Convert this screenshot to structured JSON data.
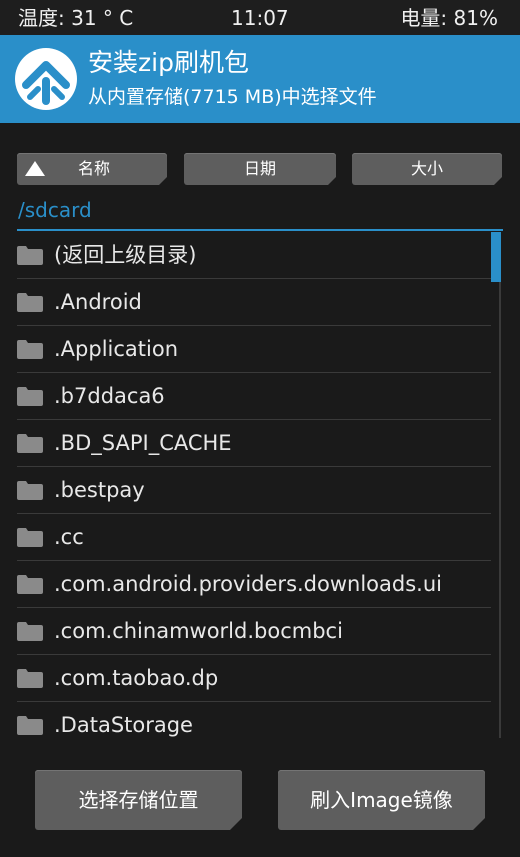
{
  "status_bar": {
    "temperature": "温度: 31 ° C",
    "time": "11:07",
    "battery": "电量: 81%"
  },
  "header": {
    "logo_icon": "twrp-logo-icon",
    "title": "安装zip刷机包",
    "subtitle": "从内置存储(7715 MB)中选择文件"
  },
  "sort_bar": {
    "name_label": "名称",
    "date_label": "日期",
    "size_label": "大小",
    "active_sort_icon": "triangle-up-icon"
  },
  "path": "/sdcard",
  "files": [
    {
      "name": "(返回上级目录)",
      "icon": "folder-icon"
    },
    {
      "name": ".Android",
      "icon": "folder-icon"
    },
    {
      "name": ".Application",
      "icon": "folder-icon"
    },
    {
      "name": ".b7ddaca6",
      "icon": "folder-icon"
    },
    {
      "name": ".BD_SAPI_CACHE",
      "icon": "folder-icon"
    },
    {
      "name": ".bestpay",
      "icon": "folder-icon"
    },
    {
      "name": ".cc",
      "icon": "folder-icon"
    },
    {
      "name": ".com.android.providers.downloads.ui",
      "icon": "folder-icon"
    },
    {
      "name": ".com.chinamworld.bocmbci",
      "icon": "folder-icon"
    },
    {
      "name": ".com.taobao.dp",
      "icon": "folder-icon"
    },
    {
      "name": ".DataStorage",
      "icon": "folder-icon"
    }
  ],
  "buttons": {
    "select_storage": "选择存储位置",
    "flash_image": "刷入Image镜像"
  },
  "colors": {
    "accent": "#2a8fc9",
    "background": "#1a1a1a",
    "button": "#5e5e5e"
  }
}
